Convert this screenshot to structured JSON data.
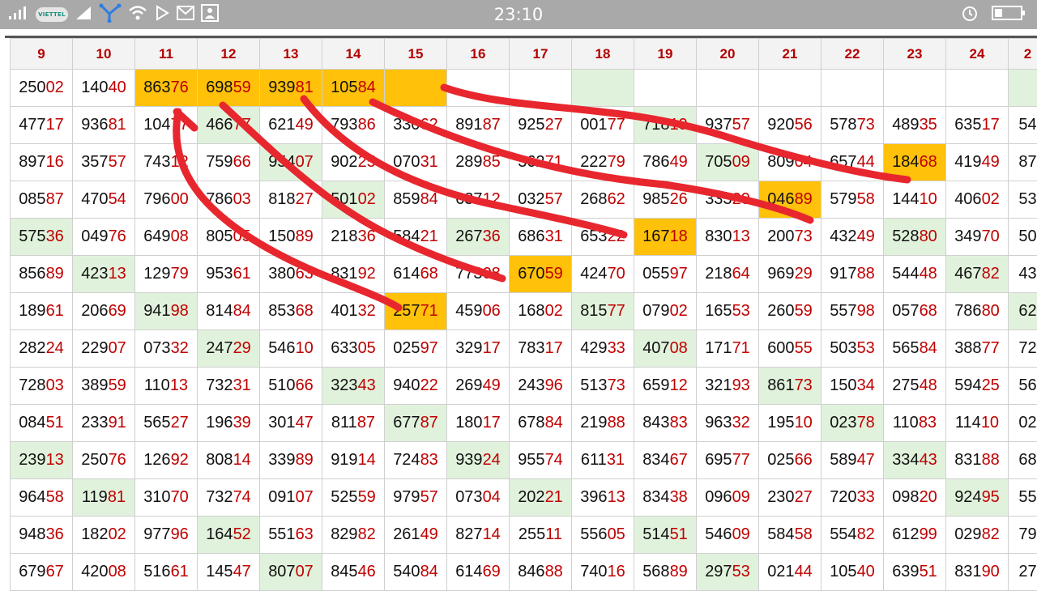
{
  "status_bar": {
    "time": "23:10",
    "carrier": "VIETTEL",
    "icons": [
      "signal-icon",
      "signal-icon",
      "transfer-icon",
      "wifi-icon",
      "play-store-icon",
      "mail-icon",
      "notification-icon",
      "alarm-icon",
      "battery-icon"
    ]
  },
  "colors": {
    "highlight_green": "#e1f2dc",
    "highlight_orange": "#ffc10a",
    "header_text": "#b30000",
    "tail_digits": "#c00000",
    "annotation_stroke": "#e8262e"
  },
  "table": {
    "columns": [
      "9",
      "10",
      "11",
      "12",
      "13",
      "14",
      "15",
      "16",
      "17",
      "18",
      "19",
      "20",
      "21",
      "22",
      "23",
      "24",
      "2"
    ],
    "rows": [
      [
        "25002",
        "14040",
        "86376",
        "69859",
        "93981",
        "10584",
        "",
        "",
        "",
        "",
        "",
        "",
        "",
        "",
        "",
        "",
        ""
      ],
      [
        "47717",
        "93681",
        "10477",
        "46677",
        "62149",
        "79386",
        "33062",
        "89187",
        "92527",
        "00177",
        "71819",
        "93757",
        "92056",
        "57873",
        "48935",
        "63517",
        "54"
      ],
      [
        "89716",
        "35757",
        "74312",
        "75966",
        "95407",
        "90225",
        "07031",
        "28985",
        "36271",
        "22279",
        "78649",
        "70509",
        "80904",
        "65744",
        "18468",
        "41949",
        "87"
      ],
      [
        "08587",
        "47054",
        "79600",
        "78603",
        "81827",
        "50102",
        "85984",
        "63712",
        "03257",
        "26862",
        "98526",
        "33320",
        "04689",
        "57958",
        "14410",
        "40602",
        "53"
      ],
      [
        "57536",
        "04976",
        "64908",
        "80505",
        "15089",
        "21836",
        "58421",
        "26736",
        "68631",
        "65322",
        "16718",
        "83013",
        "20073",
        "43249",
        "52880",
        "34970",
        "50"
      ],
      [
        "85689",
        "42313",
        "12979",
        "95361",
        "38063",
        "83192",
        "61468",
        "77308",
        "67059",
        "42470",
        "05597",
        "21864",
        "96929",
        "91788",
        "54448",
        "46782",
        "43"
      ],
      [
        "18961",
        "20669",
        "94198",
        "81484",
        "85368",
        "40132",
        "25771",
        "45906",
        "16802",
        "81577",
        "07902",
        "16553",
        "26059",
        "55798",
        "05768",
        "78680",
        "62"
      ],
      [
        "28224",
        "22907",
        "07332",
        "24729",
        "54610",
        "63305",
        "02597",
        "32917",
        "78317",
        "42933",
        "40708",
        "17171",
        "60055",
        "50353",
        "56584",
        "38877",
        "72"
      ],
      [
        "72803",
        "38959",
        "11013",
        "73231",
        "51066",
        "32343",
        "94022",
        "26949",
        "24396",
        "51373",
        "65912",
        "32193",
        "86173",
        "15034",
        "27548",
        "59425",
        "56"
      ],
      [
        "08451",
        "23391",
        "56527",
        "19639",
        "30147",
        "81187",
        "67787",
        "18017",
        "67884",
        "21988",
        "84383",
        "96332",
        "19510",
        "02378",
        "11083",
        "11410",
        "02"
      ],
      [
        "23913",
        "25076",
        "12692",
        "80814",
        "33989",
        "91914",
        "72483",
        "93924",
        "95574",
        "61131",
        "83467",
        "69577",
        "02566",
        "58947",
        "33443",
        "83188",
        "68"
      ],
      [
        "96458",
        "11981",
        "31070",
        "73274",
        "09107",
        "52559",
        "97957",
        "07304",
        "20221",
        "39613",
        "83438",
        "09609",
        "23027",
        "72033",
        "09820",
        "92495",
        "55"
      ],
      [
        "94836",
        "18202",
        "97796",
        "16452",
        "55163",
        "82982",
        "26149",
        "82714",
        "25511",
        "55605",
        "51451",
        "54609",
        "58458",
        "55482",
        "61299",
        "02982",
        "79"
      ],
      [
        "67967",
        "42008",
        "51661",
        "14547",
        "80707",
        "84546",
        "54084",
        "61469",
        "84688",
        "74016",
        "56889",
        "29753",
        "02144",
        "10540",
        "63951",
        "83190",
        "27"
      ]
    ],
    "highlights": [
      {
        "row": 0,
        "col": 2,
        "color": "orange"
      },
      {
        "row": 0,
        "col": 3,
        "color": "orange"
      },
      {
        "row": 0,
        "col": 4,
        "color": "orange"
      },
      {
        "row": 0,
        "col": 5,
        "color": "orange"
      },
      {
        "row": 0,
        "col": 6,
        "color": "orange"
      },
      {
        "row": 0,
        "col": 9,
        "color": "green"
      },
      {
        "row": 0,
        "col": 16,
        "color": "green"
      },
      {
        "row": 1,
        "col": 3,
        "color": "green"
      },
      {
        "row": 1,
        "col": 10,
        "color": "green"
      },
      {
        "row": 2,
        "col": 4,
        "color": "green"
      },
      {
        "row": 2,
        "col": 11,
        "color": "green"
      },
      {
        "row": 2,
        "col": 14,
        "color": "orange"
      },
      {
        "row": 3,
        "col": 5,
        "color": "green"
      },
      {
        "row": 3,
        "col": 12,
        "color": "orange"
      },
      {
        "row": 4,
        "col": 0,
        "color": "green"
      },
      {
        "row": 4,
        "col": 7,
        "color": "green"
      },
      {
        "row": 4,
        "col": 10,
        "color": "orange"
      },
      {
        "row": 4,
        "col": 14,
        "color": "green"
      },
      {
        "row": 5,
        "col": 1,
        "color": "green"
      },
      {
        "row": 5,
        "col": 8,
        "color": "orange"
      },
      {
        "row": 5,
        "col": 15,
        "color": "green"
      },
      {
        "row": 6,
        "col": 2,
        "color": "green"
      },
      {
        "row": 6,
        "col": 6,
        "color": "orange"
      },
      {
        "row": 6,
        "col": 9,
        "color": "green"
      },
      {
        "row": 6,
        "col": 16,
        "color": "green"
      },
      {
        "row": 7,
        "col": 3,
        "color": "green"
      },
      {
        "row": 7,
        "col": 10,
        "color": "green"
      },
      {
        "row": 8,
        "col": 5,
        "color": "green"
      },
      {
        "row": 8,
        "col": 12,
        "color": "green"
      },
      {
        "row": 9,
        "col": 6,
        "color": "green"
      },
      {
        "row": 9,
        "col": 13,
        "color": "green"
      },
      {
        "row": 10,
        "col": 0,
        "color": "green"
      },
      {
        "row": 10,
        "col": 7,
        "color": "green"
      },
      {
        "row": 10,
        "col": 14,
        "color": "green"
      },
      {
        "row": 11,
        "col": 1,
        "color": "green"
      },
      {
        "row": 11,
        "col": 8,
        "color": "green"
      },
      {
        "row": 11,
        "col": 15,
        "color": "green"
      },
      {
        "row": 12,
        "col": 3,
        "color": "green"
      },
      {
        "row": 12,
        "col": 10,
        "color": "green"
      },
      {
        "row": 13,
        "col": 4,
        "color": "green"
      },
      {
        "row": 13,
        "col": 11,
        "color": "green"
      }
    ]
  }
}
